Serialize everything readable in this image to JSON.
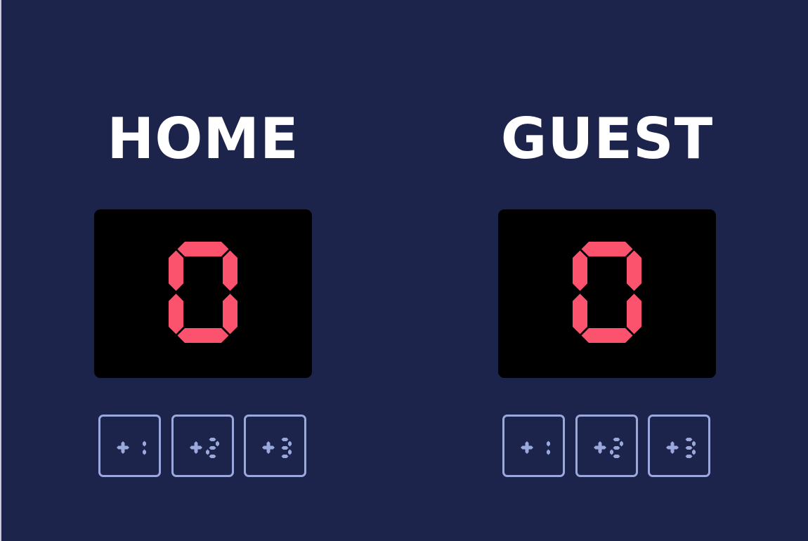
{
  "colors": {
    "background": "#1c244b",
    "display_background": "#000000",
    "score_digit": "#fb526d",
    "button_accent": "#9aa8dc",
    "team_name": "#ffffff"
  },
  "home": {
    "name": "HOME",
    "score": "0",
    "buttons": [
      {
        "label": "+1"
      },
      {
        "label": "+2"
      },
      {
        "label": "+3"
      }
    ]
  },
  "guest": {
    "name": "GUEST",
    "score": "0",
    "buttons": [
      {
        "label": "+1"
      },
      {
        "label": "+2"
      },
      {
        "label": "+3"
      }
    ]
  }
}
